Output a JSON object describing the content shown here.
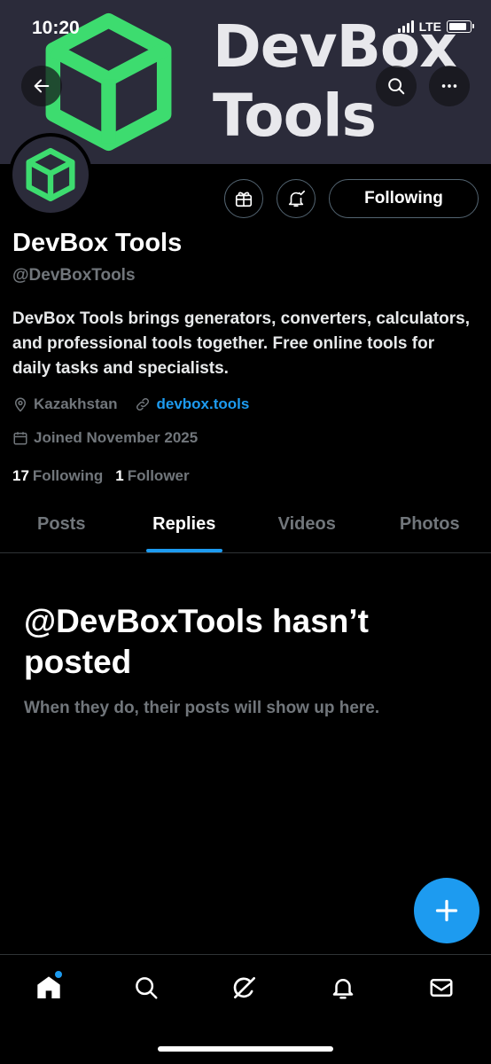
{
  "status_bar": {
    "time": "10:20",
    "network": "LTE"
  },
  "banner": {
    "title_line1": "DevBox",
    "title_line2": "Tools",
    "logo_color": "#3ddc6f",
    "background": "#2b2b3a"
  },
  "profile": {
    "display_name": "DevBox Tools",
    "handle": "@DevBoxTools",
    "bio": "DevBox Tools brings generators, converters, calculators, and professional tools together. Free online tools for daily tasks and specialists.",
    "location": "Kazakhstan",
    "website": "devbox.tools",
    "joined": "Joined November 2025",
    "following_count": "17",
    "following_label": "Following",
    "followers_count": "1",
    "followers_label": "Follower",
    "follow_button_label": "Following"
  },
  "tabs": [
    {
      "label": "Posts",
      "active": false
    },
    {
      "label": "Replies",
      "active": true
    },
    {
      "label": "Videos",
      "active": false
    },
    {
      "label": "Photos",
      "active": false
    }
  ],
  "empty_state": {
    "title": "@DevBoxTools hasn’t posted",
    "subtitle": "When they do, their posts will show up here."
  },
  "icons": {
    "back": "arrow-left-icon",
    "search": "search-icon",
    "more": "more-icon",
    "gift": "gift-icon",
    "notify": "bell-plus-icon",
    "location": "location-pin-icon",
    "link": "link-icon",
    "calendar": "calendar-icon",
    "compose": "plus-icon",
    "nav_home": "home-icon",
    "nav_search": "search-icon",
    "nav_grok": "grok-icon",
    "nav_notifications": "bell-icon",
    "nav_messages": "mail-icon"
  },
  "colors": {
    "accent": "#1d9bf0",
    "muted": "#71767b"
  }
}
